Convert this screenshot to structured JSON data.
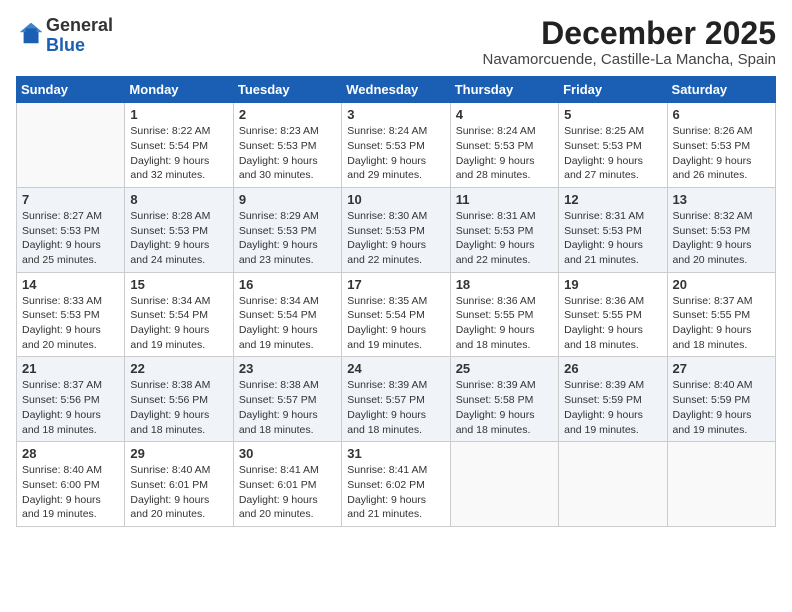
{
  "logo": {
    "general": "General",
    "blue": "Blue"
  },
  "title": "December 2025",
  "location": "Navamorcuende, Castille-La Mancha, Spain",
  "days_header": [
    "Sunday",
    "Monday",
    "Tuesday",
    "Wednesday",
    "Thursday",
    "Friday",
    "Saturday"
  ],
  "weeks": [
    [
      {
        "day": "",
        "sunrise": "",
        "sunset": "",
        "daylight": ""
      },
      {
        "day": "1",
        "sunrise": "Sunrise: 8:22 AM",
        "sunset": "Sunset: 5:54 PM",
        "daylight": "Daylight: 9 hours and 32 minutes."
      },
      {
        "day": "2",
        "sunrise": "Sunrise: 8:23 AM",
        "sunset": "Sunset: 5:53 PM",
        "daylight": "Daylight: 9 hours and 30 minutes."
      },
      {
        "day": "3",
        "sunrise": "Sunrise: 8:24 AM",
        "sunset": "Sunset: 5:53 PM",
        "daylight": "Daylight: 9 hours and 29 minutes."
      },
      {
        "day": "4",
        "sunrise": "Sunrise: 8:24 AM",
        "sunset": "Sunset: 5:53 PM",
        "daylight": "Daylight: 9 hours and 28 minutes."
      },
      {
        "day": "5",
        "sunrise": "Sunrise: 8:25 AM",
        "sunset": "Sunset: 5:53 PM",
        "daylight": "Daylight: 9 hours and 27 minutes."
      },
      {
        "day": "6",
        "sunrise": "Sunrise: 8:26 AM",
        "sunset": "Sunset: 5:53 PM",
        "daylight": "Daylight: 9 hours and 26 minutes."
      }
    ],
    [
      {
        "day": "7",
        "sunrise": "Sunrise: 8:27 AM",
        "sunset": "Sunset: 5:53 PM",
        "daylight": "Daylight: 9 hours and 25 minutes."
      },
      {
        "day": "8",
        "sunrise": "Sunrise: 8:28 AM",
        "sunset": "Sunset: 5:53 PM",
        "daylight": "Daylight: 9 hours and 24 minutes."
      },
      {
        "day": "9",
        "sunrise": "Sunrise: 8:29 AM",
        "sunset": "Sunset: 5:53 PM",
        "daylight": "Daylight: 9 hours and 23 minutes."
      },
      {
        "day": "10",
        "sunrise": "Sunrise: 8:30 AM",
        "sunset": "Sunset: 5:53 PM",
        "daylight": "Daylight: 9 hours and 22 minutes."
      },
      {
        "day": "11",
        "sunrise": "Sunrise: 8:31 AM",
        "sunset": "Sunset: 5:53 PM",
        "daylight": "Daylight: 9 hours and 22 minutes."
      },
      {
        "day": "12",
        "sunrise": "Sunrise: 8:31 AM",
        "sunset": "Sunset: 5:53 PM",
        "daylight": "Daylight: 9 hours and 21 minutes."
      },
      {
        "day": "13",
        "sunrise": "Sunrise: 8:32 AM",
        "sunset": "Sunset: 5:53 PM",
        "daylight": "Daylight: 9 hours and 20 minutes."
      }
    ],
    [
      {
        "day": "14",
        "sunrise": "Sunrise: 8:33 AM",
        "sunset": "Sunset: 5:53 PM",
        "daylight": "Daylight: 9 hours and 20 minutes."
      },
      {
        "day": "15",
        "sunrise": "Sunrise: 8:34 AM",
        "sunset": "Sunset: 5:54 PM",
        "daylight": "Daylight: 9 hours and 19 minutes."
      },
      {
        "day": "16",
        "sunrise": "Sunrise: 8:34 AM",
        "sunset": "Sunset: 5:54 PM",
        "daylight": "Daylight: 9 hours and 19 minutes."
      },
      {
        "day": "17",
        "sunrise": "Sunrise: 8:35 AM",
        "sunset": "Sunset: 5:54 PM",
        "daylight": "Daylight: 9 hours and 19 minutes."
      },
      {
        "day": "18",
        "sunrise": "Sunrise: 8:36 AM",
        "sunset": "Sunset: 5:55 PM",
        "daylight": "Daylight: 9 hours and 18 minutes."
      },
      {
        "day": "19",
        "sunrise": "Sunrise: 8:36 AM",
        "sunset": "Sunset: 5:55 PM",
        "daylight": "Daylight: 9 hours and 18 minutes."
      },
      {
        "day": "20",
        "sunrise": "Sunrise: 8:37 AM",
        "sunset": "Sunset: 5:55 PM",
        "daylight": "Daylight: 9 hours and 18 minutes."
      }
    ],
    [
      {
        "day": "21",
        "sunrise": "Sunrise: 8:37 AM",
        "sunset": "Sunset: 5:56 PM",
        "daylight": "Daylight: 9 hours and 18 minutes."
      },
      {
        "day": "22",
        "sunrise": "Sunrise: 8:38 AM",
        "sunset": "Sunset: 5:56 PM",
        "daylight": "Daylight: 9 hours and 18 minutes."
      },
      {
        "day": "23",
        "sunrise": "Sunrise: 8:38 AM",
        "sunset": "Sunset: 5:57 PM",
        "daylight": "Daylight: 9 hours and 18 minutes."
      },
      {
        "day": "24",
        "sunrise": "Sunrise: 8:39 AM",
        "sunset": "Sunset: 5:57 PM",
        "daylight": "Daylight: 9 hours and 18 minutes."
      },
      {
        "day": "25",
        "sunrise": "Sunrise: 8:39 AM",
        "sunset": "Sunset: 5:58 PM",
        "daylight": "Daylight: 9 hours and 18 minutes."
      },
      {
        "day": "26",
        "sunrise": "Sunrise: 8:39 AM",
        "sunset": "Sunset: 5:59 PM",
        "daylight": "Daylight: 9 hours and 19 minutes."
      },
      {
        "day": "27",
        "sunrise": "Sunrise: 8:40 AM",
        "sunset": "Sunset: 5:59 PM",
        "daylight": "Daylight: 9 hours and 19 minutes."
      }
    ],
    [
      {
        "day": "28",
        "sunrise": "Sunrise: 8:40 AM",
        "sunset": "Sunset: 6:00 PM",
        "daylight": "Daylight: 9 hours and 19 minutes."
      },
      {
        "day": "29",
        "sunrise": "Sunrise: 8:40 AM",
        "sunset": "Sunset: 6:01 PM",
        "daylight": "Daylight: 9 hours and 20 minutes."
      },
      {
        "day": "30",
        "sunrise": "Sunrise: 8:41 AM",
        "sunset": "Sunset: 6:01 PM",
        "daylight": "Daylight: 9 hours and 20 minutes."
      },
      {
        "day": "31",
        "sunrise": "Sunrise: 8:41 AM",
        "sunset": "Sunset: 6:02 PM",
        "daylight": "Daylight: 9 hours and 21 minutes."
      },
      {
        "day": "",
        "sunrise": "",
        "sunset": "",
        "daylight": ""
      },
      {
        "day": "",
        "sunrise": "",
        "sunset": "",
        "daylight": ""
      },
      {
        "day": "",
        "sunrise": "",
        "sunset": "",
        "daylight": ""
      }
    ]
  ]
}
